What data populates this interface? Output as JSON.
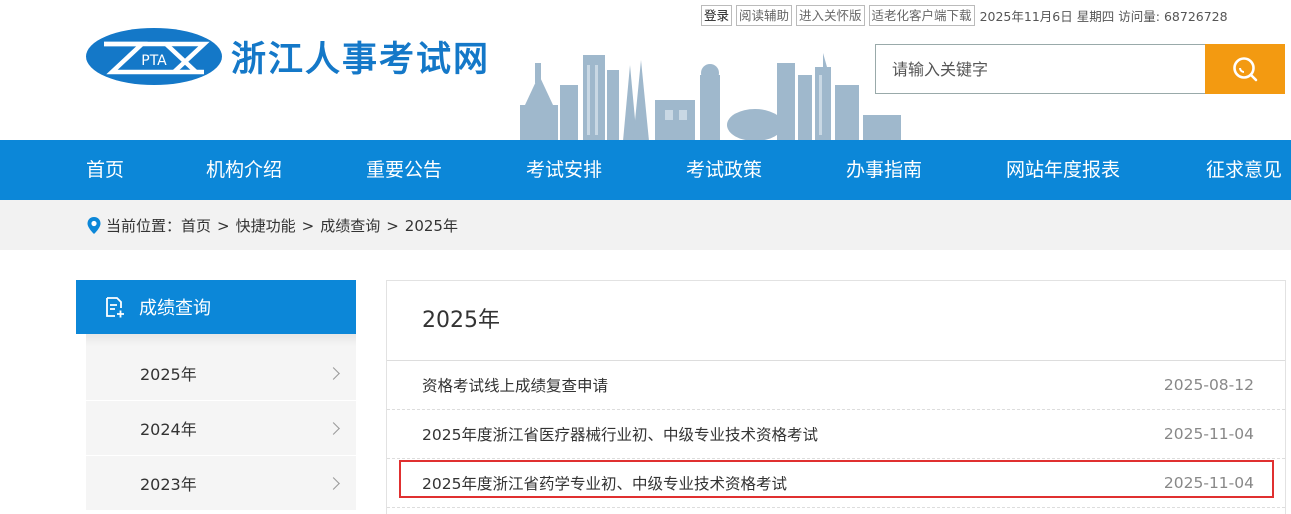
{
  "topbar": {
    "login": "登录",
    "reading_aid": "阅读辅助",
    "care_version": "进入关怀版",
    "elderly_client": "适老化客户端下载",
    "date": "2025年11月6日",
    "weekday": "星期四",
    "visits_label": "访问量:",
    "visits": "68726728"
  },
  "logo": {
    "text": "PTA",
    "title": "浙江人事考试网"
  },
  "search": {
    "placeholder": "请输入关键字"
  },
  "nav": [
    "首页",
    "机构介绍",
    "重要公告",
    "考试安排",
    "考试政策",
    "办事指南",
    "网站年度报表",
    "征求意见"
  ],
  "breadcrumb": {
    "label": "当前位置：",
    "items": [
      "首页",
      "快捷功能",
      "成绩查询",
      "2025年"
    ],
    "separator": ">"
  },
  "sidebar": {
    "title": "成绩查询",
    "items": [
      "2025年",
      "2024年",
      "2023年"
    ]
  },
  "main": {
    "title": "2025年",
    "rows": [
      {
        "title": "资格考试线上成绩复查申请",
        "date": "2025-08-12"
      },
      {
        "title": "2025年度浙江省医疗器械行业初、中级专业技术资格考试",
        "date": "2025-11-04"
      },
      {
        "title": "2025年度浙江省药学专业初、中级专业技术资格考试",
        "date": "2025-11-04"
      }
    ]
  },
  "colors": {
    "primary": "#0c87d8",
    "accent": "#f39a11",
    "highlight": "#e03030"
  }
}
